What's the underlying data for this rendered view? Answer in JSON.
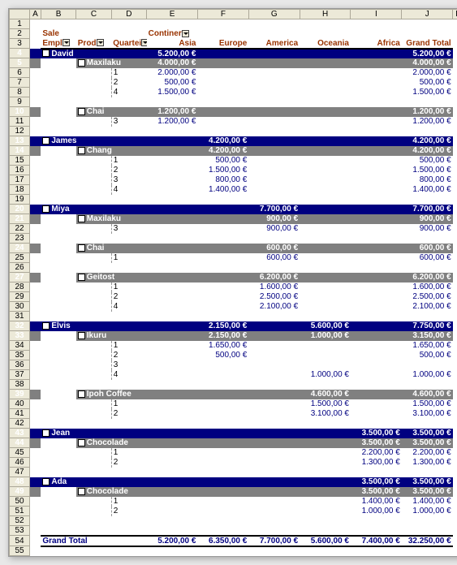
{
  "cols": [
    "",
    "A",
    "B",
    "C",
    "D",
    "E",
    "F",
    "G",
    "H",
    "I",
    "J",
    "K"
  ],
  "labels": {
    "sale": "Sale",
    "continent": "Continer",
    "emp": "Empl",
    "prod": "Prod",
    "qtr": "Quartei",
    "grandTotal": "Grand Total"
  },
  "regions": [
    "Asia",
    "Europe",
    "America",
    "Oceania",
    "Africa",
    "Grand Total"
  ],
  "employees": [
    {
      "name": "David",
      "totals": [
        "5.200,00 €",
        "",
        "",
        "",
        "",
        "5.200,00 €"
      ],
      "products": [
        {
          "name": "Maxilaku",
          "subtotal": [
            "4.000,00 €",
            "",
            "",
            "",
            "",
            "4.000,00 €"
          ],
          "quarters": [
            {
              "q": "1",
              "v": [
                "2.000,00 €",
                "",
                "",
                "",
                "",
                "2.000,00 €"
              ]
            },
            {
              "q": "2",
              "v": [
                "500,00 €",
                "",
                "",
                "",
                "",
                "500,00 €"
              ]
            },
            {
              "q": "4",
              "v": [
                "1.500,00 €",
                "",
                "",
                "",
                "",
                "1.500,00 €"
              ]
            }
          ]
        },
        {
          "name": "Chai",
          "subtotal": [
            "1.200,00 €",
            "",
            "",
            "",
            "",
            "1.200,00 €"
          ],
          "quarters": [
            {
              "q": "3",
              "v": [
                "1.200,00 €",
                "",
                "",
                "",
                "",
                "1.200,00 €"
              ]
            }
          ]
        }
      ]
    },
    {
      "name": "James",
      "totals": [
        "",
        "4.200,00 €",
        "",
        "",
        "",
        "4.200,00 €"
      ],
      "products": [
        {
          "name": "Chang",
          "subtotal": [
            "",
            "4.200,00 €",
            "",
            "",
            "",
            "4.200,00 €"
          ],
          "quarters": [
            {
              "q": "1",
              "v": [
                "",
                "500,00 €",
                "",
                "",
                "",
                "500,00 €"
              ]
            },
            {
              "q": "2",
              "v": [
                "",
                "1.500,00 €",
                "",
                "",
                "",
                "1.500,00 €"
              ]
            },
            {
              "q": "3",
              "v": [
                "",
                "800,00 €",
                "",
                "",
                "",
                "800,00 €"
              ]
            },
            {
              "q": "4",
              "v": [
                "",
                "1.400,00 €",
                "",
                "",
                "",
                "1.400,00 €"
              ]
            }
          ]
        }
      ]
    },
    {
      "name": "Miya",
      "totals": [
        "",
        "",
        "7.700,00 €",
        "",
        "",
        "7.700,00 €"
      ],
      "products": [
        {
          "name": "Maxilaku",
          "subtotal": [
            "",
            "",
            "900,00 €",
            "",
            "",
            "900,00 €"
          ],
          "quarters": [
            {
              "q": "3",
              "v": [
                "",
                "",
                "900,00 €",
                "",
                "",
                "900,00 €"
              ]
            }
          ]
        },
        {
          "name": "Chai",
          "subtotal": [
            "",
            "",
            "600,00 €",
            "",
            "",
            "600,00 €"
          ],
          "quarters": [
            {
              "q": "1",
              "v": [
                "",
                "",
                "600,00 €",
                "",
                "",
                "600,00 €"
              ]
            }
          ]
        },
        {
          "name": "Geitost",
          "subtotal": [
            "",
            "",
            "6.200,00 €",
            "",
            "",
            "6.200,00 €"
          ],
          "quarters": [
            {
              "q": "1",
              "v": [
                "",
                "",
                "1.600,00 €",
                "",
                "",
                "1.600,00 €"
              ]
            },
            {
              "q": "2",
              "v": [
                "",
                "",
                "2.500,00 €",
                "",
                "",
                "2.500,00 €"
              ]
            },
            {
              "q": "4",
              "v": [
                "",
                "",
                "2.100,00 €",
                "",
                "",
                "2.100,00 €"
              ]
            }
          ]
        }
      ]
    },
    {
      "name": "Elvis",
      "totals": [
        "",
        "2.150,00 €",
        "",
        "5.600,00 €",
        "",
        "7.750,00 €"
      ],
      "products": [
        {
          "name": "Ikuru",
          "subtotal": [
            "",
            "2.150,00 €",
            "",
            "1.000,00 €",
            "",
            "3.150,00 €"
          ],
          "quarters": [
            {
              "q": "1",
              "v": [
                "",
                "1.650,00 €",
                "",
                "",
                "",
                "1.650,00 €"
              ]
            },
            {
              "q": "2",
              "v": [
                "",
                "500,00 €",
                "",
                "",
                "",
                "500,00 €"
              ]
            },
            {
              "q": "3",
              "v": [
                "",
                "",
                "",
                "",
                "",
                ""
              ]
            },
            {
              "q": "4",
              "v": [
                "",
                "",
                "",
                "1.000,00 €",
                "",
                "1.000,00 €"
              ]
            }
          ]
        },
        {
          "name": "Ipoh Coffee",
          "subtotal": [
            "",
            "",
            "",
            "4.600,00 €",
            "",
            "4.600,00 €"
          ],
          "quarters": [
            {
              "q": "1",
              "v": [
                "",
                "",
                "",
                "1.500,00 €",
                "",
                "1.500,00 €"
              ]
            },
            {
              "q": "2",
              "v": [
                "",
                "",
                "",
                "3.100,00 €",
                "",
                "3.100,00 €"
              ]
            }
          ]
        }
      ]
    },
    {
      "name": "Jean",
      "totals": [
        "",
        "",
        "",
        "",
        "3.500,00 €",
        "3.500,00 €"
      ],
      "products": [
        {
          "name": "Chocolade",
          "subtotal": [
            "",
            "",
            "",
            "",
            "3.500,00 €",
            "3.500,00 €"
          ],
          "quarters": [
            {
              "q": "1",
              "v": [
                "",
                "",
                "",
                "",
                "2.200,00 €",
                "2.200,00 €"
              ]
            },
            {
              "q": "2",
              "v": [
                "",
                "",
                "",
                "",
                "1.300,00 €",
                "1.300,00 €"
              ]
            }
          ]
        }
      ]
    },
    {
      "name": "Ada",
      "totals": [
        "",
        "",
        "",
        "",
        "3.500,00 €",
        "3.500,00 €"
      ],
      "products": [
        {
          "name": "Chocolade",
          "subtotal": [
            "",
            "",
            "",
            "",
            "3.500,00 €",
            "3.500,00 €"
          ],
          "quarters": [
            {
              "q": "1",
              "v": [
                "",
                "",
                "",
                "",
                "1.400,00 €",
                "1.400,00 €"
              ]
            },
            {
              "q": "2",
              "v": [
                "",
                "",
                "",
                "",
                "1.000,00 €",
                "1.000,00 €"
              ]
            }
          ]
        }
      ]
    }
  ],
  "grandTotals": [
    "5.200,00 €",
    "6.350,00 €",
    "7.700,00 €",
    "5.600,00 €",
    "7.400,00 €",
    "32.250,00 €"
  ]
}
